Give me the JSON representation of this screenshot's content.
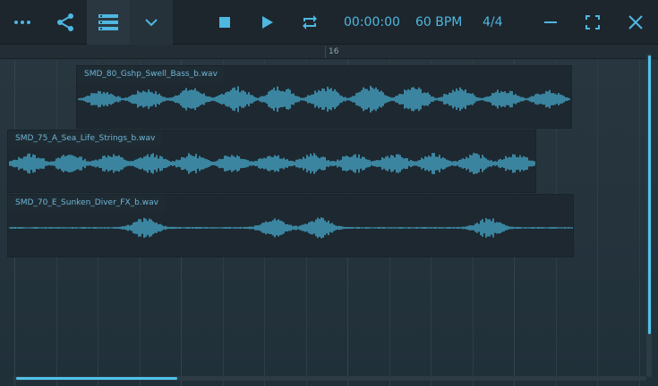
{
  "toolbar": {
    "time": "00:00:00",
    "tempo": "60 BPM",
    "time_signature": "4/4",
    "icons": [
      "more-dots-icon",
      "share-icon",
      "tracks-list-icon",
      "chevron-down-icon",
      "stop-icon",
      "play-icon",
      "loop-icon",
      "minimize-icon",
      "fullscreen-icon",
      "close-icon"
    ]
  },
  "ruler": {
    "bar_label": "16"
  },
  "clips": [
    {
      "name": "SMD_80_Gshp_Swell_Bass_b.wav"
    },
    {
      "name": "SMD_75_A_Sea_Life_Strings_b.wav"
    },
    {
      "name": "SMD_70_E_Sunken_Diver_FX_b.wav"
    }
  ],
  "colors": {
    "accent": "#4fc3ea",
    "background": "#26333c",
    "toolbar": "#1d262d",
    "clip": "#1d2830"
  }
}
